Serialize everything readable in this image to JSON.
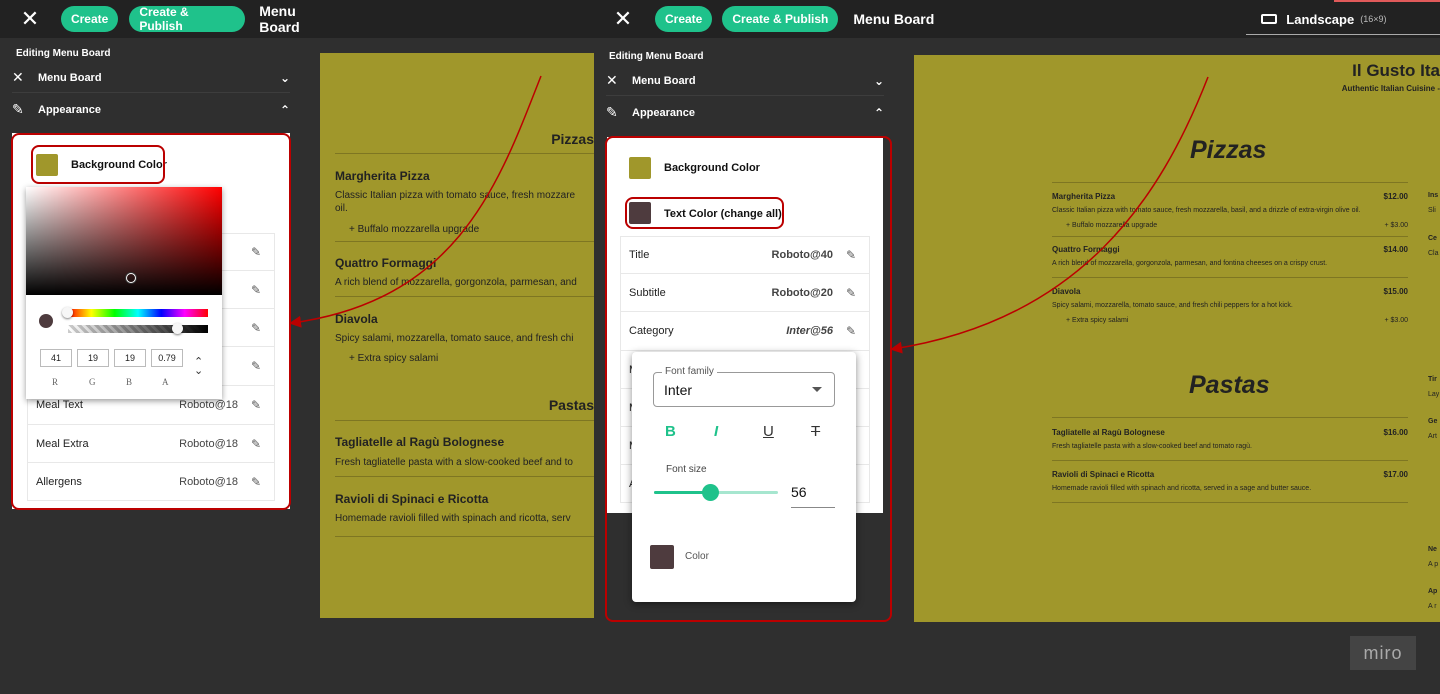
{
  "left": {
    "topbar": {
      "close": "✕",
      "create": "Create",
      "create_publish": "Create & Publish",
      "title": "Menu Board"
    },
    "sidebar": {
      "heading": "Editing Menu Board",
      "accordions": [
        {
          "label": "Menu Board",
          "icon": "utensils-icon",
          "chevron": "⌄"
        },
        {
          "label": "Appearance",
          "icon": "eyedropper-icon",
          "chevron": "⌃"
        }
      ],
      "bg_color_label": "Background Color",
      "rows": [
        {
          "name": "Meal Text",
          "value": "Roboto@18"
        },
        {
          "name": "Meal Extra",
          "value": "Roboto@18"
        },
        {
          "name": "Allergens",
          "value": "Roboto@18"
        }
      ]
    },
    "picker": {
      "r": "41",
      "g": "19",
      "b": "19",
      "a": "0.79",
      "labels": [
        "R",
        "G",
        "B",
        "A"
      ]
    },
    "menu": {
      "cat1": "Pizzas",
      "items1": [
        {
          "name": "Margherita Pizza",
          "desc": "Classic Italian pizza with tomato sauce, fresh mozzare",
          "desc2": "oil.",
          "extra": "+ Buffalo mozzarella upgrade"
        },
        {
          "name": "Quattro Formaggi",
          "desc": "A rich blend of mozzarella, gorgonzola, parmesan, and"
        },
        {
          "name": "Diavola",
          "desc": "Spicy salami, mozzarella, tomato sauce, and fresh chi",
          "extra": "+ Extra spicy salami"
        }
      ],
      "cat2": "Pastas",
      "items2": [
        {
          "name": "Tagliatelle al Ragù Bolognese",
          "desc": "Fresh tagliatelle pasta with a slow-cooked beef and to"
        },
        {
          "name": "Ravioli di Spinaci e Ricotta",
          "desc": "Homemade ravioli filled with spinach and ricotta, serv"
        }
      ]
    }
  },
  "right": {
    "topbar": {
      "close": "✕",
      "create": "Create",
      "create_publish": "Create & Publish",
      "title": "Menu Board",
      "orientation": "Landscape",
      "ratio": "(16×9)"
    },
    "sidebar": {
      "heading": "Editing Menu Board",
      "accordions": [
        {
          "label": "Menu Board",
          "icon": "utensils-icon",
          "chevron": "⌄"
        },
        {
          "label": "Appearance",
          "icon": "eyedropper-icon",
          "chevron": "⌃"
        }
      ],
      "bg_color_label": "Background Color",
      "text_color_label": "Text Color (change all)",
      "rows": [
        {
          "name": "Title",
          "value": "Roboto@40"
        },
        {
          "name": "Subtitle",
          "value": "Roboto@20"
        },
        {
          "name": "Category",
          "value": "Inter@56"
        }
      ],
      "row_initials": [
        "M",
        "M",
        "M",
        "A"
      ]
    },
    "font_popup": {
      "family_label": "Font family",
      "family_value": "Inter",
      "bold": "B",
      "italic": "I",
      "underline": "U",
      "strike": "T",
      "size_label": "Font size",
      "size_value": "56",
      "size_fraction": 0.45,
      "color_label": "Color"
    },
    "menu": {
      "title": "Il Gusto Ita",
      "subtitle": "Authentic Italian Cuisine -",
      "cat1": "Pizzas",
      "items1": [
        {
          "name": "Margherita Pizza",
          "price": "$12.00",
          "desc": "Classic Italian pizza with tomato sauce, fresh mozzarella, basil, and a drizzle of extra-virgin olive oil.",
          "extra": "+ Buffalo mozzarella upgrade",
          "extra_price": "+ $3.00"
        },
        {
          "name": "Quattro Formaggi",
          "price": "$14.00",
          "desc": "A rich blend of mozzarella, gorgonzola, parmesan, and fontina cheeses on a crispy crust."
        },
        {
          "name": "Diavola",
          "price": "$15.00",
          "desc": "Spicy salami, mozzarella, tomato sauce, and fresh chili peppers for a hot kick.",
          "extra": "+ Extra spicy salami",
          "extra_price": "+ $3.00"
        }
      ],
      "cat2": "Pastas",
      "items2": [
        {
          "name": "Tagliatelle al Ragù Bolognese",
          "price": "$16.00",
          "desc": "Fresh tagliatelle pasta with a slow-cooked beef and tomato ragù."
        },
        {
          "name": "Ravioli di Spinaci e Ricotta",
          "price": "$17.00",
          "desc": "Homemade ravioli filled with spinach and ricotta, served in a sage and butter sauce."
        }
      ],
      "edge_snippets": [
        "Ins",
        "Sli",
        "Ce",
        "Cla",
        "Tir",
        "Lay",
        "Ge",
        "Art",
        "Ne",
        "A p",
        "Ap",
        "A r"
      ]
    },
    "watermark": "miro"
  },
  "colors": {
    "bg": "#a0972b",
    "accent": "#1fc28b",
    "text_swatch": "#4e3b3e",
    "annot": "#b00000"
  }
}
